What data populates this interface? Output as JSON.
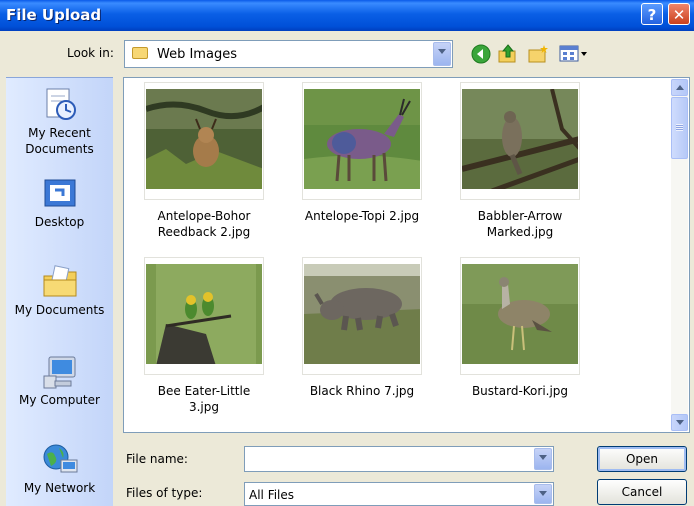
{
  "window": {
    "title": "File Upload",
    "help_label": "?",
    "close_label": "✕"
  },
  "toolbar": {
    "look_in_label": "Look in:",
    "look_in_value": "Web Images",
    "icons": [
      "back-icon",
      "up-folder-icon",
      "new-folder-icon",
      "views-icon"
    ]
  },
  "places": [
    {
      "label": "My Recent Documents",
      "icon": "recent-documents-icon"
    },
    {
      "label": "Desktop",
      "icon": "desktop-icon"
    },
    {
      "label": "My Documents",
      "icon": "my-documents-icon"
    },
    {
      "label": "My Computer",
      "icon": "my-computer-icon"
    },
    {
      "label": "My Network",
      "icon": "my-network-icon"
    }
  ],
  "files": [
    {
      "name": "Antelope-Bohor Reedback 2.jpg",
      "l1": "Antelope-Bohor",
      "l2": "Reedback 2.jpg"
    },
    {
      "name": "Antelope-Topi 2.jpg",
      "l1": "Antelope-Topi 2.jpg",
      "l2": ""
    },
    {
      "name": "Babbler-Arrow Marked.jpg",
      "l1": "Babbler-Arrow",
      "l2": "Marked.jpg"
    },
    {
      "name": "Bee Eater-Little 3.jpg",
      "l1": "Bee Eater-Little 3.jpg",
      "l2": ""
    },
    {
      "name": "Black Rhino 7.jpg",
      "l1": "Black Rhino 7.jpg",
      "l2": ""
    },
    {
      "name": "Bustard-Kori.jpg",
      "l1": "Bustard-Kori.jpg",
      "l2": ""
    }
  ],
  "form": {
    "file_name_label": "File name:",
    "file_name_value": "",
    "file_type_label": "Files of type:",
    "file_type_value": "All Files"
  },
  "buttons": {
    "open": "Open",
    "cancel": "Cancel"
  }
}
